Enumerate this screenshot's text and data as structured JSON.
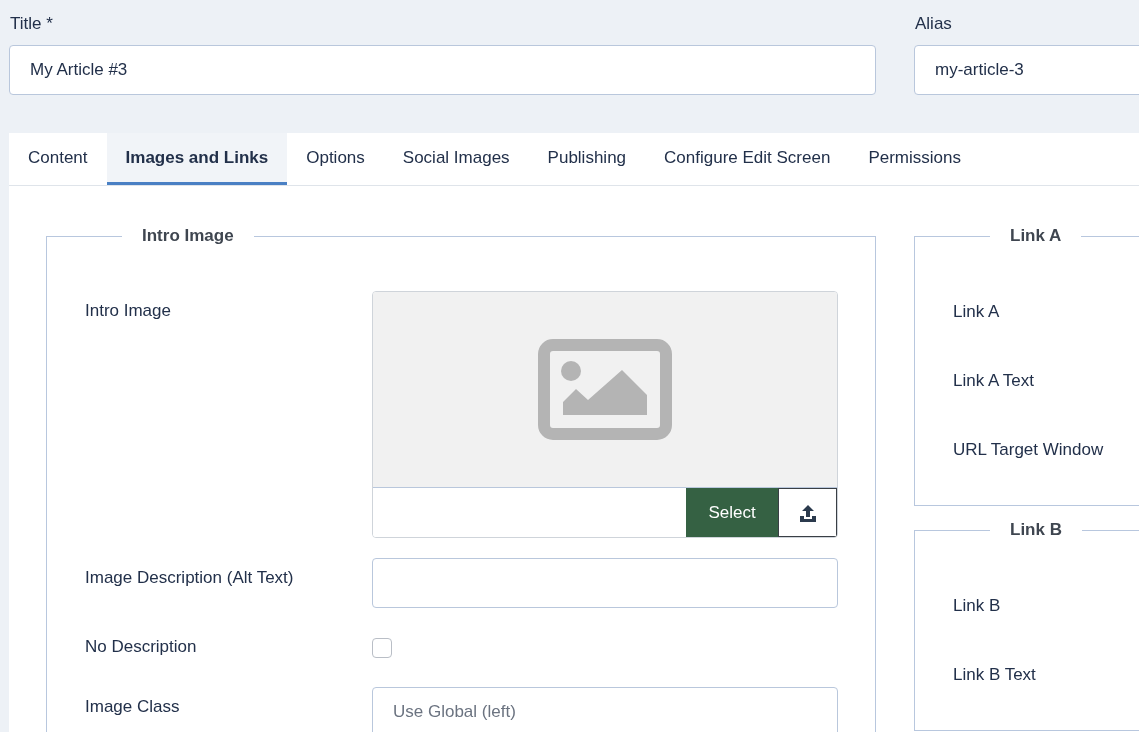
{
  "title_field": {
    "label": "Title *",
    "value": "My Article #3"
  },
  "alias_field": {
    "label": "Alias",
    "value": "my-article-3"
  },
  "tabs": [
    {
      "label": "Content",
      "selected": false
    },
    {
      "label": "Images and Links",
      "selected": true
    },
    {
      "label": "Options",
      "selected": false
    },
    {
      "label": "Social Images",
      "selected": false
    },
    {
      "label": "Publishing",
      "selected": false
    },
    {
      "label": "Configure Edit Screen",
      "selected": false
    },
    {
      "label": "Permissions",
      "selected": false
    }
  ],
  "intro_image": {
    "legend": "Intro Image",
    "fields": [
      {
        "kind": "media",
        "label": "Intro Image",
        "button": "Select"
      },
      {
        "kind": "text",
        "label": "Image Description (Alt Text)"
      },
      {
        "kind": "checkbox",
        "label": "No Description",
        "checked": false
      },
      {
        "kind": "text",
        "label": "Image Class",
        "placeholder": "Use Global (left)"
      }
    ]
  },
  "link_groups": [
    {
      "legend": "Link A",
      "fields": [
        "Link A",
        "Link A Text",
        "URL Target Window"
      ]
    },
    {
      "legend": "Link B",
      "fields": [
        "Link B",
        "Link B Text"
      ]
    }
  ]
}
